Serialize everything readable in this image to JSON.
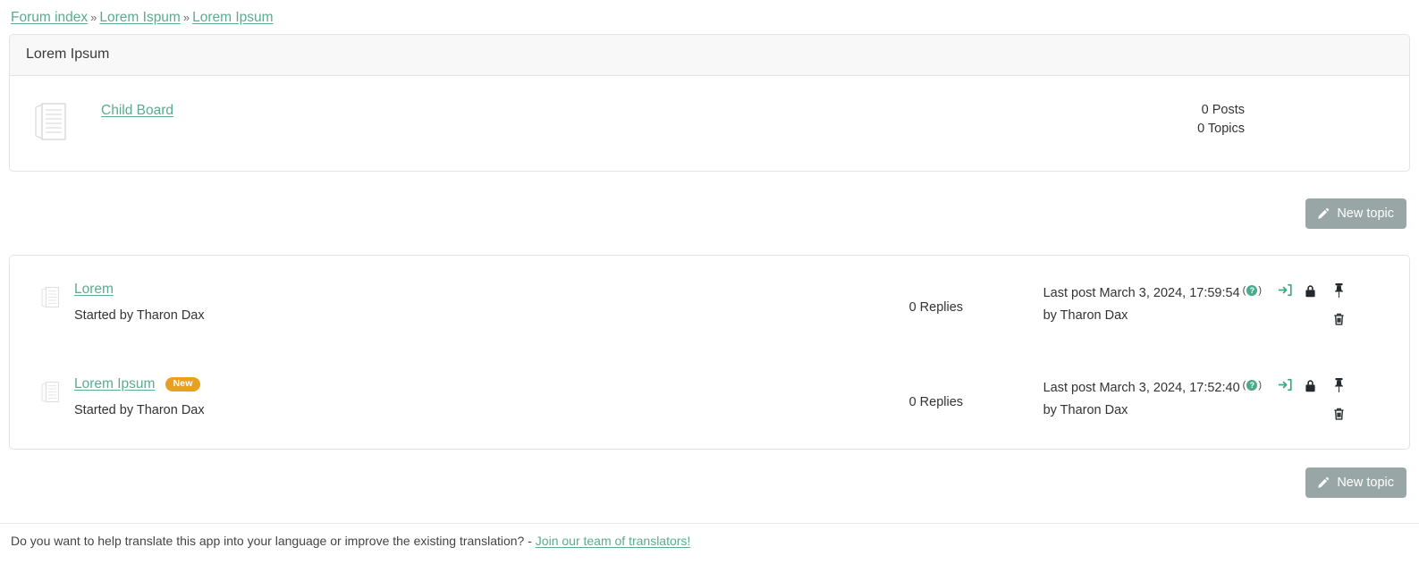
{
  "breadcrumb": {
    "separator": "»",
    "items": [
      {
        "label": "Forum index"
      },
      {
        "label": "Lorem Ispum"
      },
      {
        "label": "Lorem Ipsum"
      }
    ]
  },
  "board_panel": {
    "title": "Lorem Ipsum",
    "child_boards": [
      {
        "icon": "board-pages-icon",
        "name": "Child Board",
        "posts": "0 Posts",
        "topics": "0 Topics"
      }
    ]
  },
  "toolbar": {
    "new_topic_label": "New topic",
    "new_topic_icon": "pencil-icon",
    "button_color": "#99a6a6"
  },
  "topics": [
    {
      "icon": "topic-pages-icon",
      "title": "Lorem",
      "badge": null,
      "started_by": "Started by Tharon Dax",
      "replies": "0 Replies",
      "last_post": "Last post March 3, 2024, 17:59:54",
      "help_glyph": "?",
      "last_post_by": "by Tharon Dax",
      "goto_icon": "go-to-last-post-icon",
      "actions": [
        {
          "icon": "lock-icon"
        },
        {
          "icon": "pin-icon"
        },
        {
          "icon": "trash-icon"
        }
      ]
    },
    {
      "icon": "topic-pages-icon",
      "title": "Lorem Ipsum",
      "badge": "New",
      "started_by": "Started by Tharon Dax",
      "replies": "0 Replies",
      "last_post": "Last post March 3, 2024, 17:52:40",
      "help_glyph": "?",
      "last_post_by": "by Tharon Dax",
      "goto_icon": "go-to-last-post-icon",
      "actions": [
        {
          "icon": "lock-icon"
        },
        {
          "icon": "pin-icon"
        },
        {
          "icon": "trash-icon"
        }
      ]
    }
  ],
  "footer": {
    "text": "Do you want to help translate this app into your language or improve the existing translation? -",
    "link_label": "Join our team of translators!"
  },
  "colors": {
    "link": "#5aab8f",
    "badge_new": "#e9a020",
    "button_grey": "#99a6a6",
    "help_circle": "#4aab8c"
  }
}
